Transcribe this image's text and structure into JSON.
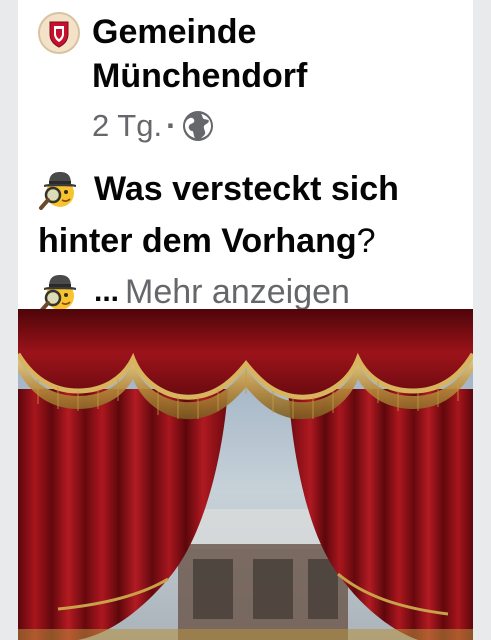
{
  "post": {
    "page_name": "Gemeinde Münchendorf",
    "time": "2 Tg.",
    "separator": "·",
    "privacy_icon": "globe-icon",
    "text_line1": "Was versteckt sich",
    "text_line2": "hinter dem Vorhang",
    "text_line2_end": "?",
    "ellipsis": "...",
    "see_more": "Mehr anzeigen",
    "emoji": "detective-emoji",
    "image": "theatre-curtain-image"
  },
  "colors": {
    "curtain": "#8e1016",
    "fringe": "#c9a14a",
    "secondary_text": "#65676b"
  }
}
